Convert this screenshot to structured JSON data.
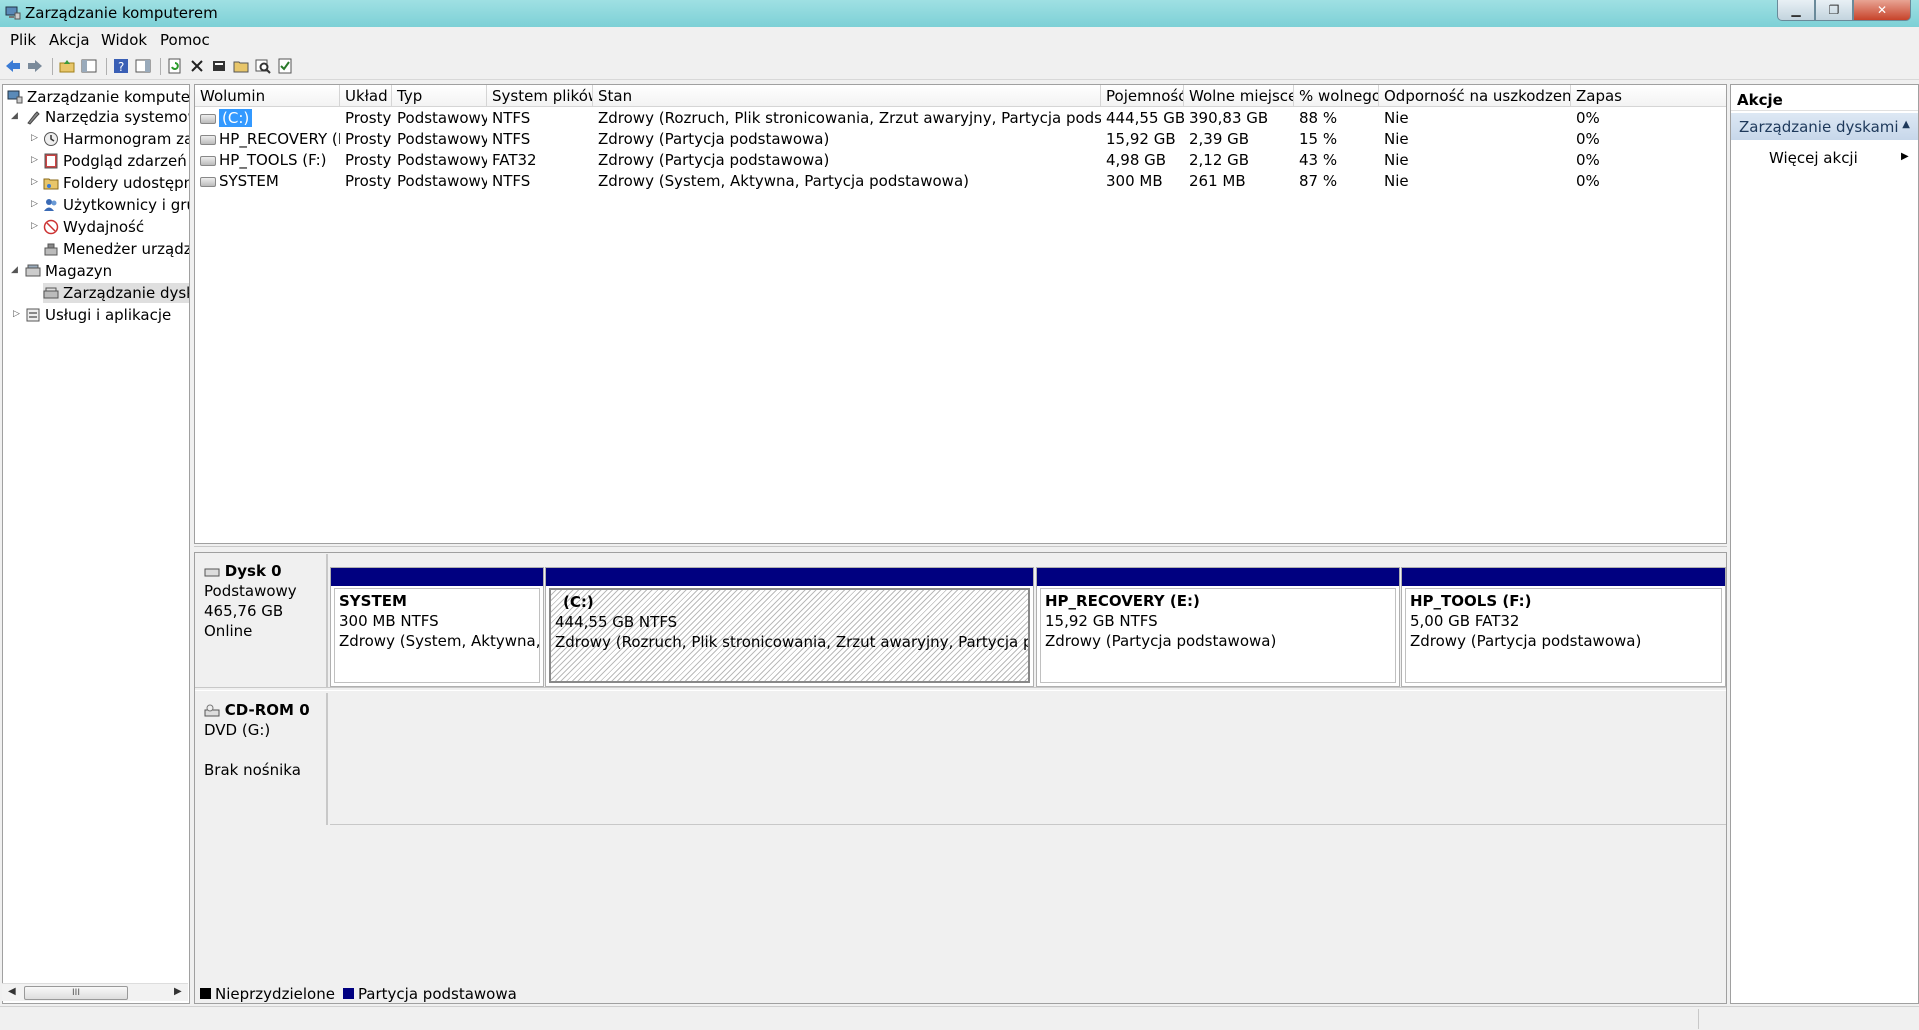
{
  "window": {
    "title": "Zarządzanie komputerem"
  },
  "menu": [
    "Plik",
    "Akcja",
    "Widok",
    "Pomoc"
  ],
  "tree": {
    "root": "Zarządzanie komputerem",
    "items": [
      {
        "label": "Narzędzia systemowe"
      },
      {
        "label": "Harmonogram zad"
      },
      {
        "label": "Podgląd zdarzeń"
      },
      {
        "label": "Foldery udostępnic"
      },
      {
        "label": "Użytkownicy i grup"
      },
      {
        "label": "Wydajność"
      },
      {
        "label": "Menedżer urządzeń"
      },
      {
        "label": "Magazyn"
      },
      {
        "label": "Zarządzanie dyska"
      },
      {
        "label": "Usługi i aplikacje"
      }
    ]
  },
  "table": {
    "headers": [
      "Wolumin",
      "Układ",
      "Typ",
      "System plików",
      "Stan",
      "Pojemność",
      "Wolne miejsce",
      "% wolnego",
      "Odporność na uszkodzenia",
      "Zapas"
    ],
    "rows": [
      [
        "(C:)",
        "Prosty",
        "Podstawowy",
        "NTFS",
        "Zdrowy (Rozruch, Plik stronicowania, Zrzut awaryjny, Partycja podstawowa)",
        "444,55 GB",
        "390,83 GB",
        "88 %",
        "Nie",
        "0%"
      ],
      [
        "HP_RECOVERY (E:)",
        "Prosty",
        "Podstawowy",
        "NTFS",
        "Zdrowy (Partycja podstawowa)",
        "15,92 GB",
        "2,39 GB",
        "15 %",
        "Nie",
        "0%"
      ],
      [
        "HP_TOOLS (F:)",
        "Prosty",
        "Podstawowy",
        "FAT32",
        "Zdrowy (Partycja podstawowa)",
        "4,98 GB",
        "2,12 GB",
        "43 %",
        "Nie",
        "0%"
      ],
      [
        "SYSTEM",
        "Prosty",
        "Podstawowy",
        "NTFS",
        "Zdrowy (System, Aktywna, Partycja podstawowa)",
        "300 MB",
        "261 MB",
        "87 %",
        "Nie",
        "0%"
      ]
    ]
  },
  "disk0": {
    "name": "Dysk 0",
    "type": "Podstawowy",
    "size": "465,76 GB",
    "status": "Online",
    "partitions": [
      {
        "name": "SYSTEM",
        "size": "300 MB NTFS",
        "status": "Zdrowy (System, Aktywna, Partycja podstawowa)"
      },
      {
        "name": "(C:)",
        "size": "444,55 GB NTFS",
        "status": "Zdrowy (Rozruch, Plik stronicowania, Zrzut awaryjny, Partycja podstawowa)"
      },
      {
        "name": "HP_RECOVERY  (E:)",
        "size": "15,92 GB NTFS",
        "status": "Zdrowy (Partycja podstawowa)"
      },
      {
        "name": "HP_TOOLS  (F:)",
        "size": "5,00 GB FAT32",
        "status": "Zdrowy (Partycja podstawowa)"
      }
    ]
  },
  "cdrom0": {
    "name": "CD-ROM 0",
    "drive": "DVD (G:)",
    "media": "Brak nośnika"
  },
  "legend": {
    "unallocated": "Nieprzydzielone",
    "primary": "Partycja podstawowa",
    "unallocated_color": "#000000",
    "primary_color": "#000080"
  },
  "actions": {
    "header": "Akcje",
    "group": "Zarządzanie dyskami",
    "more": "Więcej akcji"
  },
  "scrollbar": {
    "thumb": "III"
  }
}
